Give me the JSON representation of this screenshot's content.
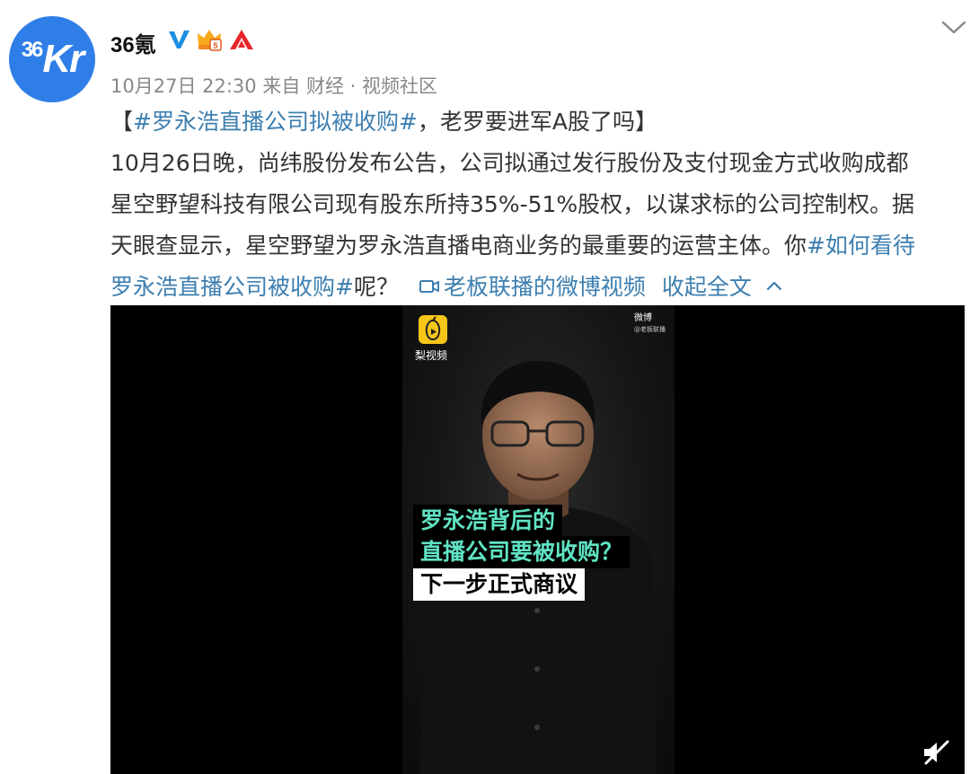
{
  "post": {
    "avatar_text_36": "36",
    "avatar_text_kr": "Kr",
    "username": "36氪",
    "badges": [
      "verified-v-icon",
      "crown-member-icon",
      "red-arrow-icon"
    ],
    "timestamp": "10月27日 22:30",
    "source": "来自 财经 · 视频社区",
    "title_bracket_open": "【",
    "title_hashtag": "#罗永浩直播公司拟被收购#",
    "title_rest": "，老罗要进军A股了吗】",
    "body_line1": "10月26日晚，尚纬股份发布公告，公司拟通过发行股份及支付现金方式收购成都",
    "body_line2": "星空野望科技有限公司现有股东所持35%-51%股权，以谋求标的公司控制权。据",
    "body_line3_text": "天眼查显示，星空野望为罗永浩直播电商业务的最重要的运营主体。你",
    "hashtag2_part1": "#如何看待",
    "hashtag2_part2": "罗永浩直播公司被收购#",
    "body_line4_tail": "呢？",
    "video_link": "老板联播的微博视频",
    "collapse_label": "收起全文"
  },
  "video": {
    "pear_label": "梨视频",
    "weibo_watermark": "微博",
    "weibo_watermark_sub": "@老板联播",
    "caption_line1": "罗永浩背后的",
    "caption_line2": "直播公司要被收购？",
    "caption_line3": "下一步正式商议"
  },
  "colors": {
    "link": "#3d7fb0",
    "caption_green": "#60e3c3",
    "avatar_blue": "#2f7ee8"
  }
}
